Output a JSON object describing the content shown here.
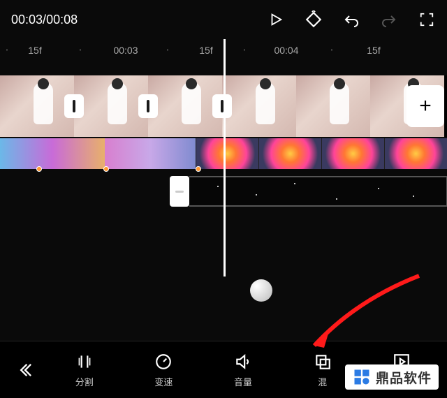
{
  "header": {
    "current_time": "00:03",
    "total_time": "00:08"
  },
  "ruler": {
    "labels": [
      "15f",
      "00:03",
      "15f",
      "00:04",
      "15f"
    ]
  },
  "clips": {
    "count": 6,
    "add_label": "+"
  },
  "tools": {
    "split": "分割",
    "speed": "变速",
    "volume": "音量",
    "blend": "混"
  },
  "watermark": {
    "text": "鼎品软件"
  }
}
